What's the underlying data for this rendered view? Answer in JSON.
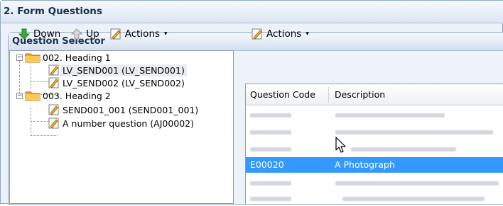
{
  "outer_panel": {
    "title": "2. Form Questions"
  },
  "inner_panel": {
    "title": "Question Selector"
  },
  "left_toolbar": {
    "down_label": "Down",
    "up_label": "Up",
    "actions_label": "Actions",
    "caret": "▾"
  },
  "right_toolbar": {
    "actions_label": "Actions",
    "caret": "▾"
  },
  "tree": {
    "groups": [
      {
        "label": "002. Heading 1",
        "expander": "−",
        "items": [
          {
            "label": "LV_SEND001 (LV_SEND001)"
          },
          {
            "label": "LV_SEND002 (LV_SEND002)"
          }
        ]
      },
      {
        "label": "003. Heading 2",
        "expander": "−",
        "items": [
          {
            "label": "SEND001_001 (SEND001_001)"
          },
          {
            "label": "A number question (AJ00002)"
          }
        ]
      }
    ]
  },
  "grid": {
    "columns": [
      "Question Code",
      "Description"
    ],
    "selected_row": {
      "code": "E00020",
      "description": "A Photograph"
    }
  },
  "colors": {
    "selection_blue": "#3399ff",
    "folder_orange": "#f2a629",
    "arrow_green": "#3aa83a",
    "header_text": "#15314f"
  }
}
